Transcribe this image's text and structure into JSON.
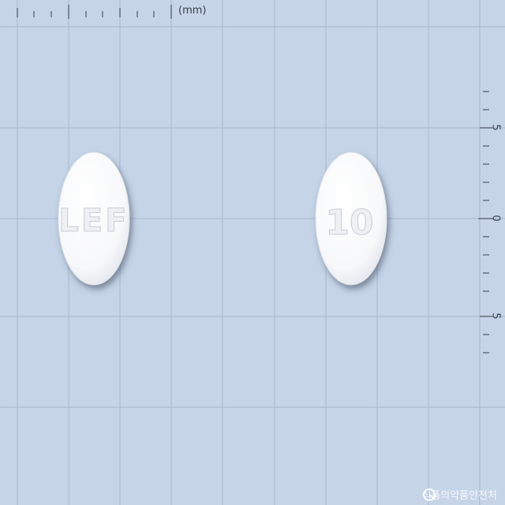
{
  "ruler": {
    "unit_label": "(mm)",
    "vertical_labels": [
      "5",
      "0",
      "5"
    ]
  },
  "pills": [
    {
      "imprint": "LEF",
      "color": "#ffffff"
    },
    {
      "imprint": "10",
      "color": "#ffffff"
    }
  ],
  "watermark": {
    "text": "식품의약품안전처",
    "icon": "mfds-logo-icon"
  },
  "colors": {
    "background": "#c5d4e7",
    "grid": "#aebdd3"
  }
}
